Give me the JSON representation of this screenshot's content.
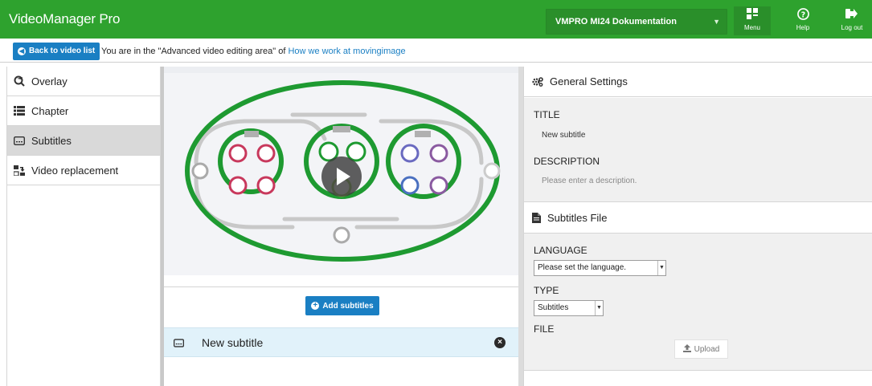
{
  "app": {
    "title": "VideoManager Pro"
  },
  "header": {
    "videomanager_select": "VMPRO MI24 Dokumentation",
    "menu_label": "Menu",
    "help_label": "Help",
    "logout_label": "Log out"
  },
  "subbar": {
    "back_label": "Back to video list",
    "area_text": "You are in the \"Advanced video editing area\" of",
    "area_link": "How we work at movingimage"
  },
  "sidebar": {
    "items": [
      {
        "label": "Overlay",
        "icon": "overlay-icon"
      },
      {
        "label": "Chapter",
        "icon": "chapter-list-icon"
      },
      {
        "label": "Subtitles",
        "icon": "subtitles-icon",
        "active": true
      },
      {
        "label": "Video replacement",
        "icon": "video-replacement-icon"
      }
    ]
  },
  "center": {
    "add_subtitles_label": "Add subtitles",
    "subtitle_row_title": "New subtitle"
  },
  "right": {
    "general_settings": {
      "heading": "General Settings",
      "title_label": "TITLE",
      "title_value": "New subtitle",
      "description_label": "DESCRIPTION",
      "description_placeholder": "Please enter a description."
    },
    "subtitles_file": {
      "heading": "Subtitles File",
      "language_label": "LANGUAGE",
      "language_value": "Please set the language.",
      "type_label": "TYPE",
      "type_value": "Subtitles",
      "file_label": "FILE",
      "upload_label": "Upload"
    }
  },
  "colors": {
    "brand_green": "#2ea22e",
    "accent_blue": "#1a7fc3",
    "active_row_bg": "#e1f2fa"
  }
}
